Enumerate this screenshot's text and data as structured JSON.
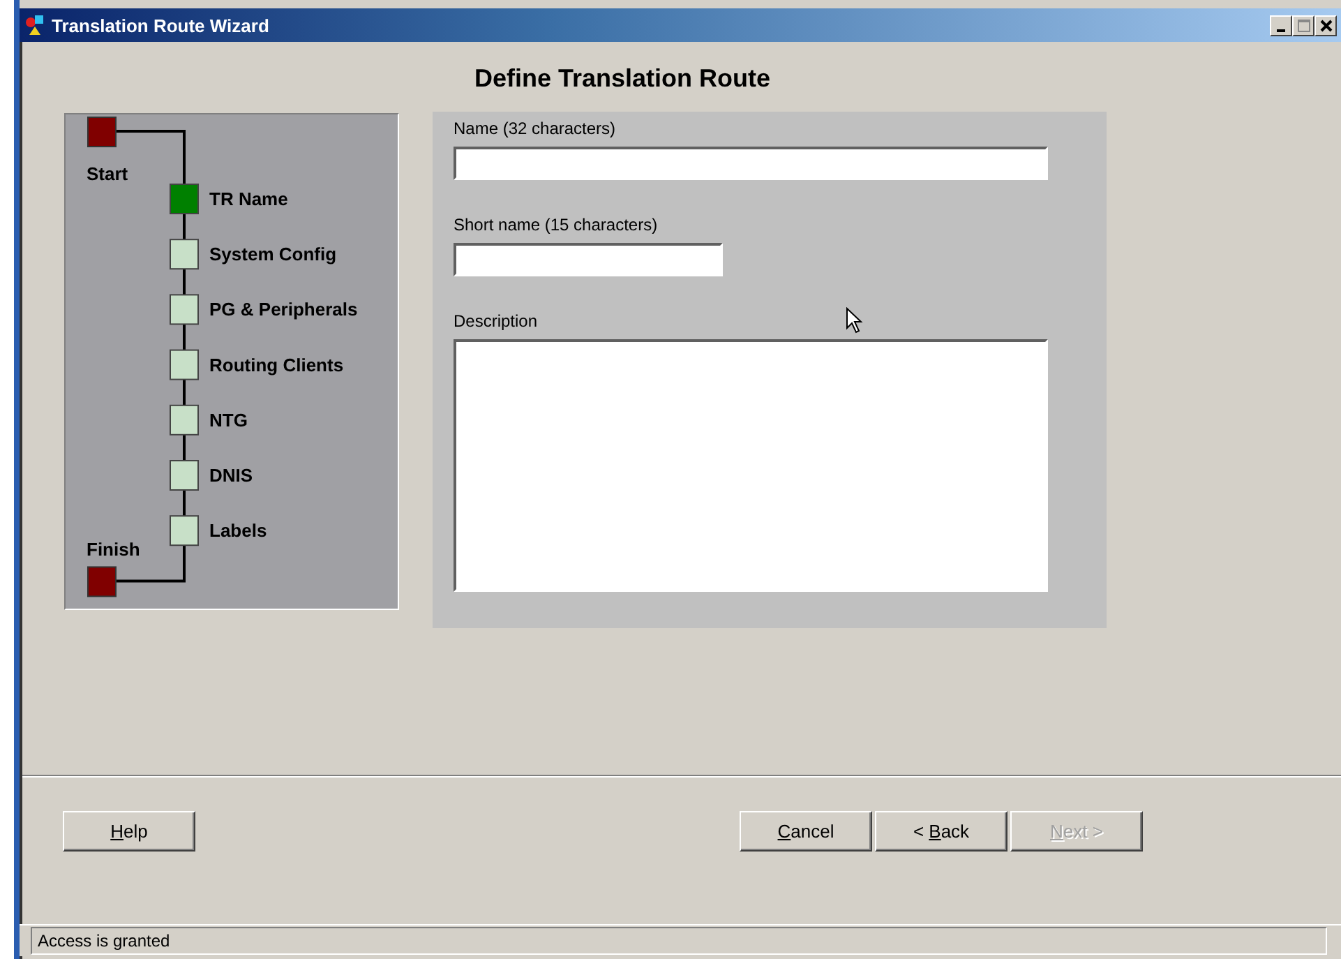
{
  "window": {
    "title": "Translation Route Wizard"
  },
  "heading": "Define Translation Route",
  "steps": [
    {
      "kind": "start",
      "label": "Start"
    },
    {
      "kind": "step",
      "label": "TR Name",
      "selected": true
    },
    {
      "kind": "step",
      "label": "System Config",
      "selected": false
    },
    {
      "kind": "step",
      "label": "PG & Peripherals",
      "selected": false
    },
    {
      "kind": "step",
      "label": "Routing Clients",
      "selected": false
    },
    {
      "kind": "step",
      "label": "NTG",
      "selected": false
    },
    {
      "kind": "step",
      "label": "DNIS",
      "selected": false
    },
    {
      "kind": "step",
      "label": "Labels",
      "selected": false
    },
    {
      "kind": "finish",
      "label": "Finish"
    }
  ],
  "fields": [
    {
      "kind": "line",
      "label": "Name (32 characters)"
    },
    {
      "kind": "short_line",
      "label": "Short name (15 characters)"
    },
    {
      "kind": "area",
      "label": "Description"
    }
  ],
  "buttons": [
    {
      "label": "Help",
      "disabled": false
    },
    {
      "label": "Cancel",
      "disabled": false
    },
    {
      "label": "< Back",
      "disabled": false
    },
    {
      "label": "Next >",
      "disabled": true
    }
  ],
  "status_bar": "Access is granted"
}
